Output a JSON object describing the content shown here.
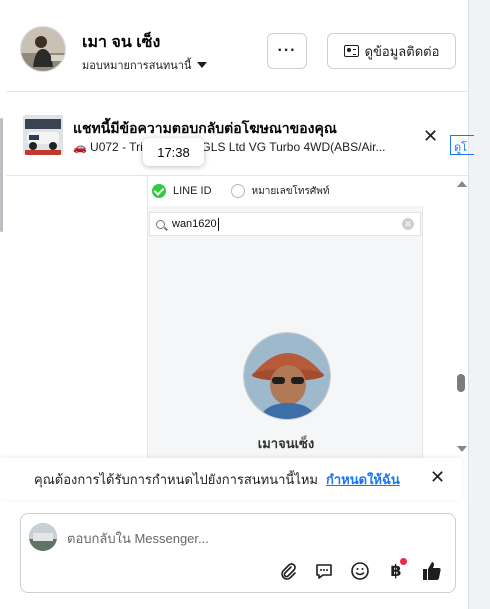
{
  "header": {
    "name": "เมา จน เซ็ง",
    "assign_label": "มอบหมายการสนทนานี้",
    "more_label": "···",
    "contact_label": "ดูข้อมูลติดต่อ"
  },
  "ad_banner": {
    "title": "แชทนี้มีข้อความตอบกลับต่อโฆษณาของคุณ",
    "subtitle": "U072 - Tri                    e Cab 2.5 GLS Ltd VG Turbo 4WD(ABS/Air...",
    "view_label": "ดูโ"
  },
  "tooltip": {
    "time": "17:38"
  },
  "shared_image": {
    "radio_line": "LINE ID",
    "radio_phone": "หมายเลขโทรศัพท์",
    "search_value": "wan1620",
    "profile_name": "เมาจนเซ็ง"
  },
  "notification": {
    "text": "คุณต้องการได้รับการกำหนดไปยังการสนทนานี้ไหม",
    "link": "กำหนดให้ฉัน"
  },
  "composer": {
    "placeholder": "ตอบกลับใน Messenger..."
  },
  "colors": {
    "accent": "#1877f2",
    "badge": "#f02849",
    "line_green": "#2ecc40"
  },
  "icons": [
    "card-icon",
    "close-icon",
    "car-icon",
    "search-icon",
    "clear-icon",
    "attach-icon",
    "message-icon",
    "emoji-icon",
    "baht-icon",
    "thumbs-up-icon"
  ]
}
